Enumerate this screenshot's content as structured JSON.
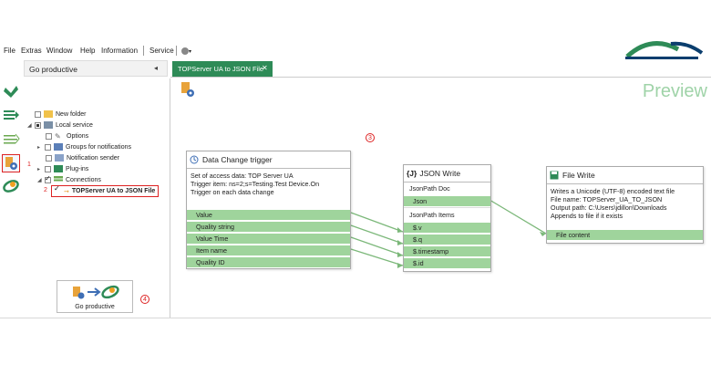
{
  "menu": {
    "items": [
      "File",
      "Extras",
      "Window",
      "Help",
      "Information",
      "Service"
    ]
  },
  "tree_panel": {
    "title": "Go productive",
    "collapse_glyph": "◂",
    "items": [
      {
        "label": "New folder"
      },
      {
        "label": "Local service"
      },
      {
        "label": "Options"
      },
      {
        "label": "Groups for notifications"
      },
      {
        "label": "Notification sender"
      },
      {
        "label": "Plug-ins"
      },
      {
        "label": "Connections"
      },
      {
        "label": "TOPServer UA to JSON File"
      }
    ],
    "go_productive_label": "Go productive"
  },
  "tabs": [
    {
      "label": "TOPServer UA to JSON File",
      "close": "✕"
    }
  ],
  "canvas": {
    "preview_label": "Preview",
    "markers": {
      "m1": "1",
      "m2": "2",
      "m3": "3",
      "m4": "4"
    },
    "nodes": {
      "trigger": {
        "title": "Data Change trigger",
        "desc": [
          "Set of access data: TOP Server UA",
          "Trigger item: ns=2;s=Testing.Test Device.On",
          "Trigger on each data change"
        ],
        "ports": [
          "Value",
          "Quality string",
          "Value Time",
          "Item name",
          "Quality ID"
        ]
      },
      "json": {
        "title": "JSON Write",
        "title_icon": "{J}",
        "rows": [
          "JsonPath Doc",
          "Json",
          "JsonPath Items",
          "$.v",
          "$.q",
          "$.timestamp",
          "$.id"
        ]
      },
      "file": {
        "title": "File Write",
        "desc": [
          "Writes a Unicode (UTF-8) encoded text file",
          "File name: TOPServer_UA_TO_JSON",
          "Output path: C:\\Users\\jdillon\\Downloads",
          "Appends to file if it exists"
        ],
        "port": "File content"
      }
    }
  },
  "colors": {
    "accent": "#2e8b57",
    "port_fill": "#9fd49c",
    "connector": "#7cb87a",
    "marker": "#dd2222",
    "preview_text": "#9fd3a8"
  }
}
